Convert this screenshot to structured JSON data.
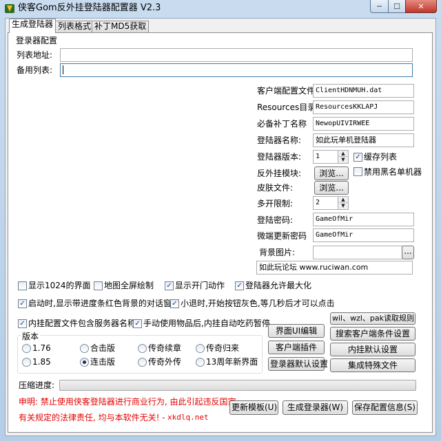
{
  "window": {
    "title": "侠客Gom反外挂登陆器配置器 V2.3",
    "min": "─",
    "max": "☐",
    "close": "✕"
  },
  "tabs": [
    "生成登陆器",
    "列表格式",
    "补丁MD5获取"
  ],
  "section_title": "登录器配置",
  "list_url": {
    "label": "列表地址:",
    "value": ""
  },
  "backup_list": {
    "label": "备用列表:",
    "value": ""
  },
  "config": {
    "client_config_file": {
      "label": "客户端配置文件",
      "value": "ClientHDNMUH.dat"
    },
    "resources_dir": {
      "label": "Resources目录",
      "value": "ResourcesKKLAPJ"
    },
    "required_patch": {
      "label": "必备补丁名称",
      "value": "NewopUIVIRWEE"
    },
    "launcher_name": {
      "label": "登陆器名称:",
      "value": "如此玩单机登陆器"
    },
    "launcher_version": {
      "label": "登陆器版本:",
      "value": "1"
    },
    "cache_list": "缓存列表",
    "anti_cheat_module": {
      "label": "反外挂模块:",
      "button": "浏览..."
    },
    "disable_blacklist": "禁用黑名单机器",
    "skin_file": {
      "label": "皮肤文件:",
      "button": "浏览..."
    },
    "multi_open": {
      "label": "多开限制:",
      "value": "2"
    },
    "launcher_password": {
      "label": "登陆密码:",
      "value": "GameOfMir"
    },
    "microupdate_password": {
      "label": "微端更新密码",
      "value": "GameOfMir"
    },
    "background_image": {
      "label": "背景图片:",
      "value": "",
      "button": "..."
    },
    "forum": "如此玩论坛 www.ruciwan.com"
  },
  "options_row1": [
    {
      "label": "显示1024的界面",
      "checked": false
    },
    {
      "label": "地图全屏绘制",
      "checked": false
    },
    {
      "label": "显示开门动作",
      "checked": true
    },
    {
      "label": "登陆器允许最大化",
      "checked": true
    }
  ],
  "option_progress_dialog": {
    "label": "启动时,显示带进度条红色背景的对话窗",
    "checked": true
  },
  "option_minor_quit": {
    "label": "小退时,开始按钮灰色,等几秒后才可以点击",
    "checked": true
  },
  "option_embed_server_name": {
    "label": "内挂配置文件包含服务器名称",
    "checked": true
  },
  "option_auto_potion": {
    "label": "手动使用物品后,内挂自动吃药暂停",
    "checked": true
  },
  "version_group": {
    "title": "版本",
    "options": [
      "1.76",
      "合击版",
      "传奇续章",
      "传奇归来",
      "1.85",
      "连击版",
      "传奇外传",
      "13周年新界面"
    ],
    "selected": "连击版"
  },
  "buttons": {
    "ui_edit": "界面UI编辑",
    "client_plugin": "客户端插件",
    "launcher_default": "登录器默认设置",
    "read_rules": "wil、wzl、pak读取规则",
    "search_client_settings": "搜索客户端条件设置",
    "plugin_default": "内挂默认设置",
    "integrate_files": "集成特殊文件",
    "update_template": "更新模板(U)",
    "build_launcher": "生成登录器(W)",
    "save_config": "保存配置信息(S)"
  },
  "progress": {
    "label": "压缩进度:",
    "value": 0
  },
  "disclaimer": {
    "line1": "申明: 禁止使用侠客登陆器进行商业行为, 由此引起违反国家",
    "line2": "有关规定的法律责任, 均与本软件无关! -",
    "site": "xkdlq.net"
  }
}
